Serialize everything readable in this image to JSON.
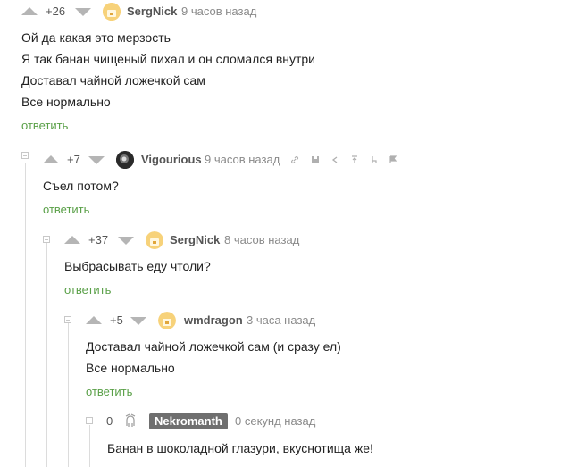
{
  "comments": [
    {
      "rating": "+26",
      "author": "SergNick",
      "time": "9 часов назад",
      "lines": [
        "Ой да какая это мерзость",
        "Я так банан чищеный пихал и он сломался внутри",
        "Доставал чайной ложечкой сам",
        "Все нормально"
      ],
      "reply": "ответить"
    },
    {
      "rating": "+7",
      "author": "Vigourious",
      "time": "9 часов назад",
      "lines": [
        "Съел потом?"
      ],
      "reply": "ответить",
      "tools": [
        "link-icon",
        "save-icon",
        "share-icon",
        "top-icon",
        "branch-icon",
        "report-flag-icon"
      ]
    },
    {
      "rating": "+37",
      "author": "SergNick",
      "time": "8 часов назад",
      "lines": [
        "Выбрасывать еду чтоли?"
      ],
      "reply": "ответить"
    },
    {
      "rating": "+5",
      "author": "wmdragon",
      "time": "3 часа назад",
      "lines": [
        "Доставал чайной ложечкой сам (и сразу ел)",
        "Все нормально"
      ],
      "reply": "ответить"
    },
    {
      "rating": "0",
      "author": "Nekromanth",
      "time": "0 секунд назад",
      "lines": [
        "Банан в шоколадной глазури, вкуснотища же!"
      ]
    }
  ],
  "colors": {
    "reply": "#5aa048",
    "badge": "#6f6f6f",
    "vote": "#b5b5b5"
  }
}
